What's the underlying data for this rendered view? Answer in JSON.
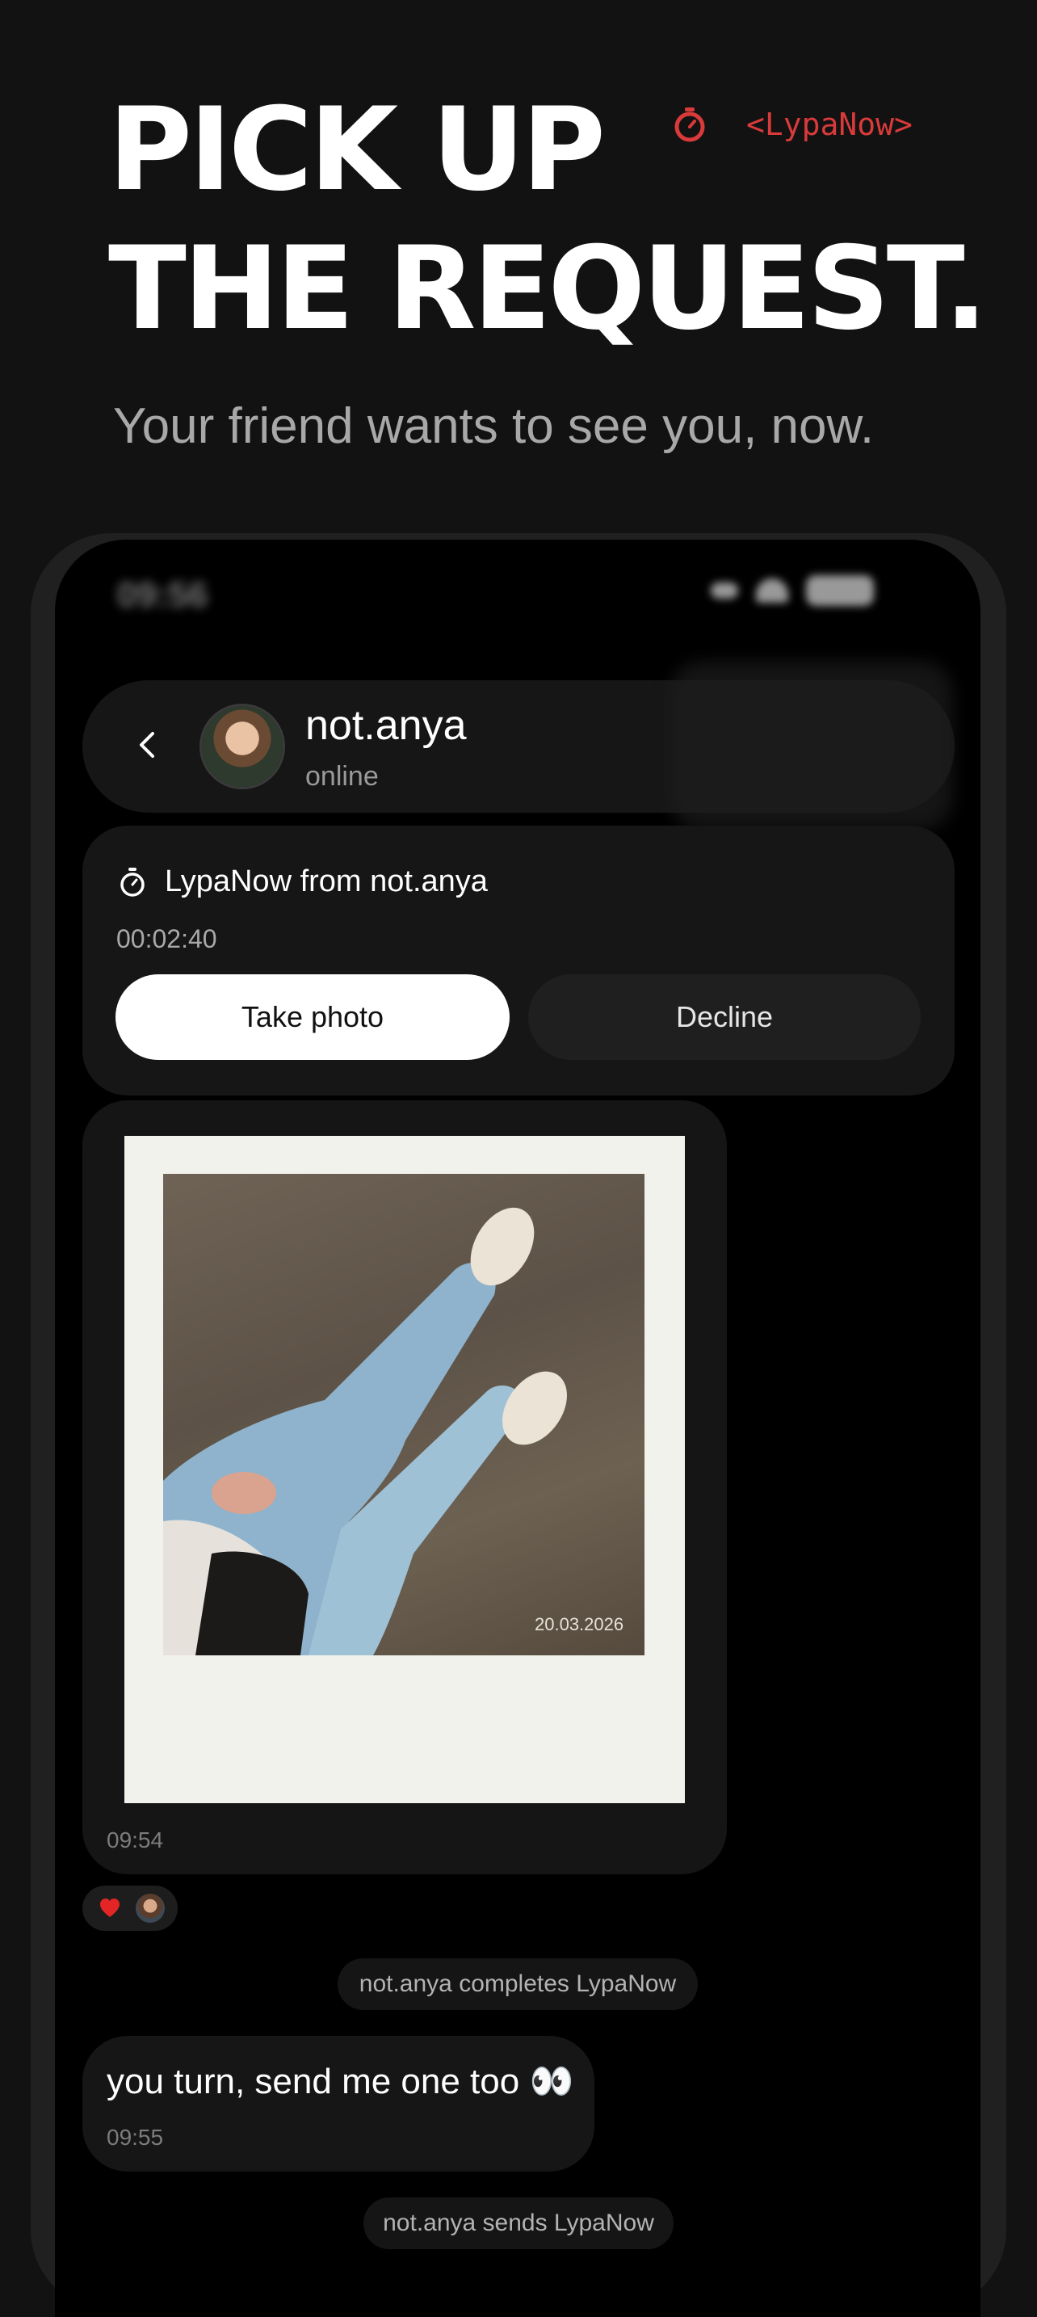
{
  "promo": {
    "title_line1": "PICK UP",
    "title_line2": "THE REQUEST.",
    "subtitle": "Your friend wants to see you, now.",
    "brand": "<LypaNow>",
    "brand_icon": "stopwatch-icon",
    "accent_color": "#d93a3a"
  },
  "status_bar": {
    "time": "09:56"
  },
  "chat": {
    "back_icon": "chevron-left-icon",
    "contact_name": "not.anya",
    "contact_status": "online"
  },
  "request": {
    "icon": "stopwatch-icon",
    "title": "LypaNow from not.anya",
    "timer": "00:02:40",
    "take_photo_label": "Take photo",
    "decline_label": "Decline"
  },
  "messages": {
    "photo": {
      "date_stamp": "20.03.2026",
      "time": "09:54",
      "reaction_icon": "heart-icon"
    },
    "system_1": "not.anya completes LypaNow",
    "text_message": {
      "text": "you turn, send me one too 👀",
      "time": "09:55"
    },
    "system_2": "not.anya sends LypaNow"
  }
}
